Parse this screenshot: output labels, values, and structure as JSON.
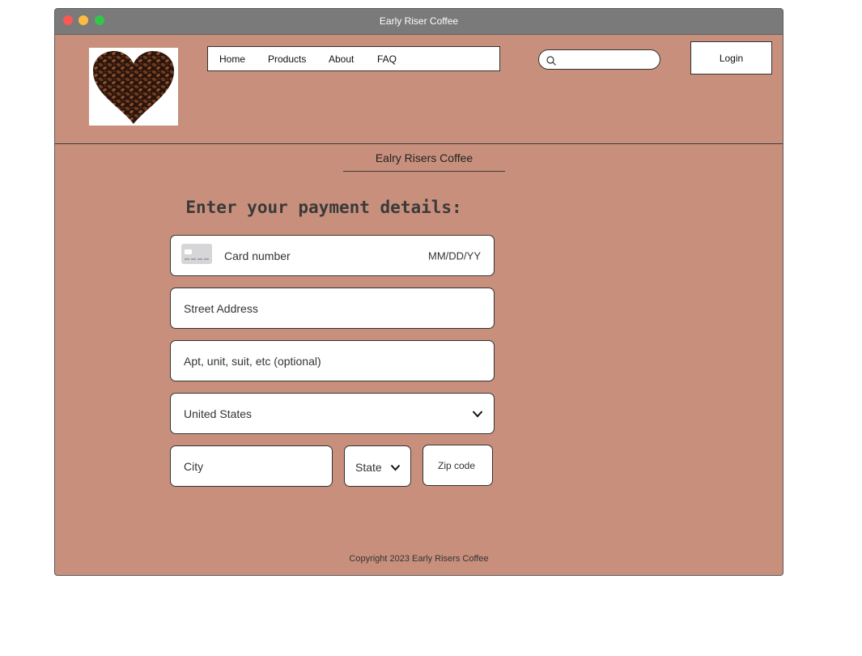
{
  "window": {
    "title": "Early Riser Coffee"
  },
  "nav": {
    "items": [
      "Home",
      "Products",
      "About",
      "FAQ"
    ]
  },
  "search": {
    "placeholder": ""
  },
  "header": {
    "login_label": "Login",
    "store_name": "Ealry Risers Coffee"
  },
  "form": {
    "heading": "Enter your payment details:",
    "card_number_placeholder": "Card number",
    "expiry_placeholder": "MM/DD/YY",
    "street_placeholder": "Street Address",
    "apt_placeholder": "Apt, unit, suit, etc (optional)",
    "country_value": "United States",
    "city_placeholder": "City",
    "state_value": "State",
    "zip_placeholder": "Zip code"
  },
  "footer": {
    "copyright": "Copyright 2023 Early Risers Coffee"
  },
  "colors": {
    "page_background": "#c8907c",
    "titlebar": "#7a7a7a",
    "text_dark": "#333333"
  }
}
